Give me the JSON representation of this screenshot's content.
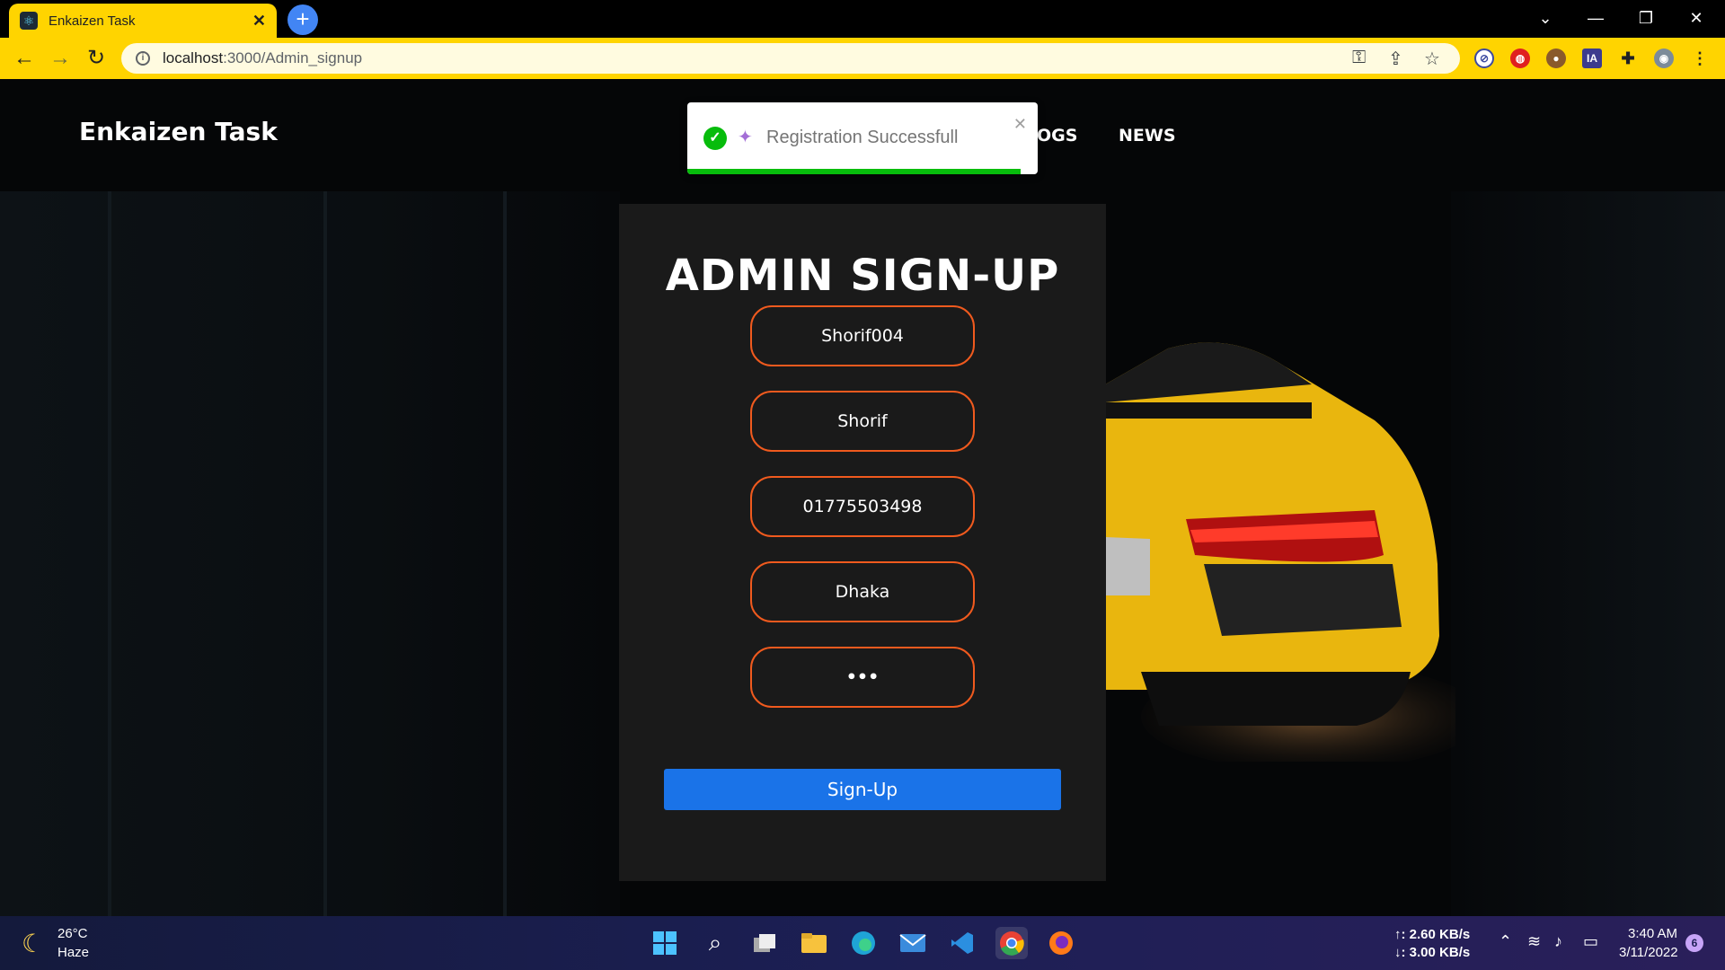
{
  "browser": {
    "tab_title": "Enkaizen Task",
    "url_host": "localhost",
    "url_path": ":3000/Admin_signup"
  },
  "site": {
    "brand": "Enkaizen Task",
    "nav": [
      "OGS",
      "NEWS"
    ]
  },
  "toast": {
    "message": "Registration Successfull",
    "progress": 0.95
  },
  "form": {
    "heading": "ADMIN SIGN-UP",
    "fields": [
      {
        "name": "username",
        "value": "Shorif004"
      },
      {
        "name": "name",
        "value": "Shorif"
      },
      {
        "name": "phone",
        "value": "01775503498"
      },
      {
        "name": "address",
        "value": "Dhaka"
      },
      {
        "name": "password",
        "value": "•••"
      }
    ],
    "submit_label": "Sign-Up"
  },
  "colors": {
    "chrome_accent": "#ffd400",
    "field_border": "#f05a1e",
    "button": "#1a73e8",
    "toast_success": "#07bc0c"
  },
  "taskbar": {
    "temperature": "26°C",
    "weather": "Haze",
    "upload": "↑: 2.60 KB/s",
    "download": "↓: 3.00 KB/s",
    "time": "3:40 AM",
    "date": "3/11/2022",
    "notifications": "6"
  }
}
